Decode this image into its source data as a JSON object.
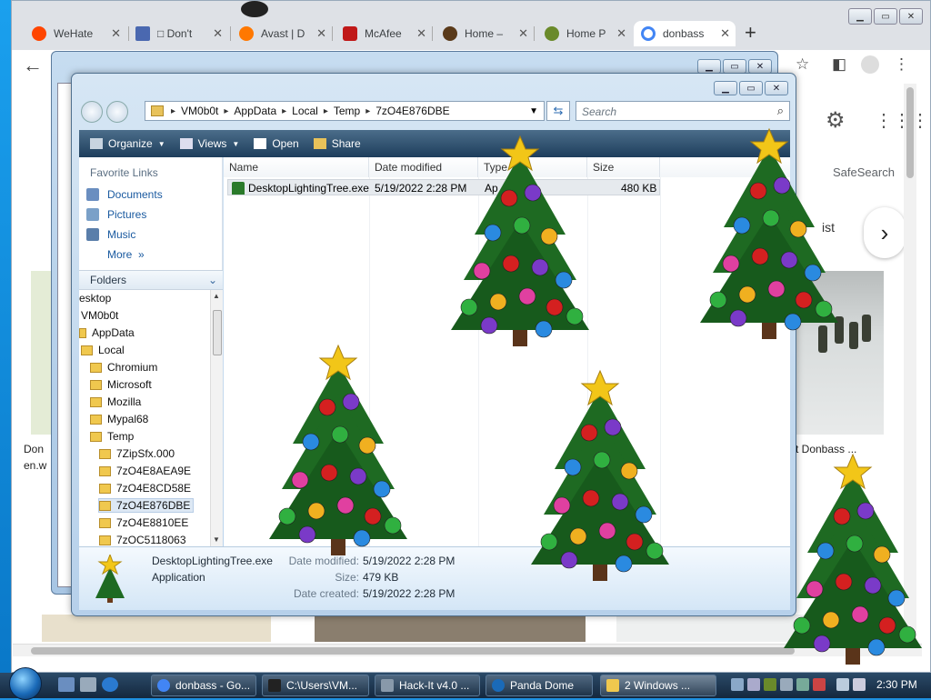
{
  "browser": {
    "tabs": [
      {
        "label": "WeHate",
        "icon": "reddit-icon",
        "color": "#ff4500"
      },
      {
        "label": "□ Don't",
        "icon": "page-icon",
        "color": "#4a68b0"
      },
      {
        "label": "",
        "icon": "avatar-icon",
        "color": "#222222"
      },
      {
        "label": "Avast | D",
        "icon": "avast-icon",
        "color": "#ff7800"
      },
      {
        "label": "McAfee",
        "icon": "mcafee-icon",
        "color": "#c01818"
      },
      {
        "label": "Home –",
        "icon": "home-site-icon",
        "color": "#5a3a1a"
      },
      {
        "label": "Home P",
        "icon": "panda-icon",
        "color": "#6a8a2a"
      },
      {
        "label": "donbass",
        "icon": "google-icon",
        "color": "#4285f4"
      }
    ],
    "new_tab": "+",
    "safesearch": "SafeSearch",
    "chip_label": "ist",
    "caption_left": "Don",
    "caption_left2": "en.w",
    "caption_right": "t Donbass ..."
  },
  "explorer": {
    "breadcrumb": [
      "VM0b0t",
      "AppData",
      "Local",
      "Temp",
      "7zO4E876DBE"
    ],
    "search_placeholder": "Search",
    "commands": {
      "organize": "Organize",
      "views": "Views",
      "open": "Open",
      "share": "Share"
    },
    "favorites_title": "Favorite Links",
    "favorites": [
      "Documents",
      "Pictures",
      "Music"
    ],
    "more": "More",
    "more_chevron": "»",
    "folders_title": "Folders",
    "tree": [
      {
        "label": "esktop",
        "indent": 0
      },
      {
        "label": "VM0b0t",
        "indent": 1
      },
      {
        "label": "AppData",
        "indent": 1
      },
      {
        "label": "Local",
        "indent": 1
      },
      {
        "label": "Chromium",
        "indent": 2
      },
      {
        "label": "Microsoft",
        "indent": 2
      },
      {
        "label": "Mozilla",
        "indent": 2
      },
      {
        "label": "Mypal68",
        "indent": 2
      },
      {
        "label": "Temp",
        "indent": 2
      },
      {
        "label": "7ZipSfx.000",
        "indent": 3
      },
      {
        "label": "7zO4E8AEA9E",
        "indent": 3
      },
      {
        "label": "7zO4E8CD58E",
        "indent": 3
      },
      {
        "label": "7zO4E876DBE",
        "indent": 3,
        "selected": true
      },
      {
        "label": "7zO4E8810EE",
        "indent": 3
      },
      {
        "label": "7zOC5118063",
        "indent": 3
      }
    ],
    "columns": [
      "Name",
      "Date modified",
      "Type",
      "Size"
    ],
    "files": [
      {
        "name": "DesktopLightingTree.exe",
        "date": "5/19/2022 2:28 PM",
        "type": "Ap",
        "size": "480 KB"
      }
    ],
    "details": {
      "name": "DesktopLightingTree.exe",
      "type": "Application",
      "date_modified_label": "Date modified:",
      "date_modified": "5/19/2022 2:28 PM",
      "size_label": "Size:",
      "size": "479 KB",
      "date_created_label": "Date created:",
      "date_created": "5/19/2022 2:28 PM"
    }
  },
  "taskbar": {
    "buttons": [
      {
        "label": "donbass - Go...",
        "icon": "chrome-icon",
        "color": "#4285f4"
      },
      {
        "label": "C:\\Users\\VM...",
        "icon": "7zip-icon",
        "color": "#222222"
      },
      {
        "label": "Hack-It v4.0 ...",
        "icon": "hackit-icon",
        "color": "#8899aa"
      },
      {
        "label": "Panda Dome",
        "icon": "panda-icon",
        "color": "#1a6ab8"
      },
      {
        "label": "2 Windows ...",
        "icon": "folder-icon",
        "color": "#f0c84e"
      }
    ],
    "clock": "2:30 PM"
  },
  "colors": {
    "desktop": "#1e90e0",
    "tree_green": "#1e6a22",
    "cmdbar": "#2a4a6a"
  }
}
